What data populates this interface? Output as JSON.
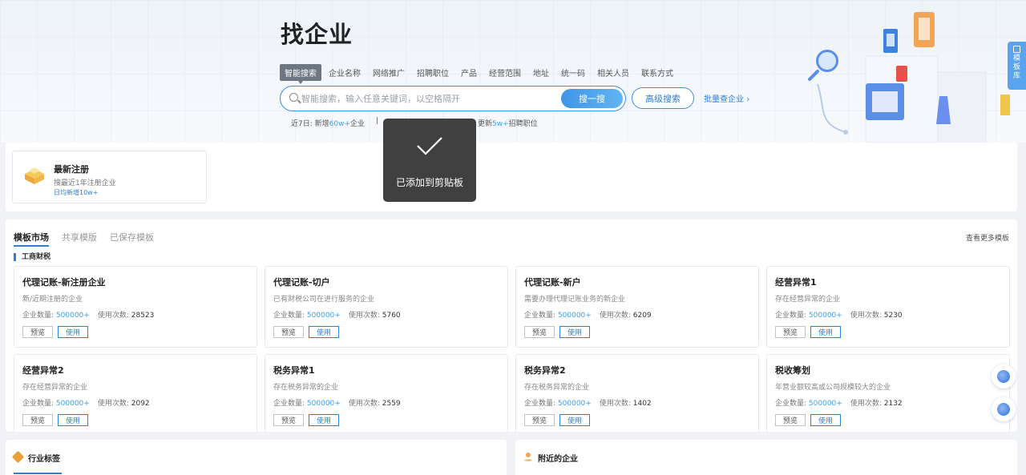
{
  "hero": {
    "title": "找企业",
    "tabs": [
      "智能搜索",
      "企业名称",
      "网络推广",
      "招聘职位",
      "产品",
      "经营范围",
      "地址",
      "统一码",
      "相关人员",
      "联系方式"
    ],
    "active_tab": "智能搜索",
    "search_placeholder": "智能搜索，输入任意关键词，以空格隔开",
    "search_button": "搜一搜",
    "advanced_button": "高级搜索",
    "batch_link": "批量查企业",
    "stats": {
      "prefix": "近7日:",
      "new_label": "新增",
      "new_count": "60w+",
      "new_suffix": "企业",
      "separator": "|",
      "update_label": "更新",
      "update_count": "5w+",
      "update_suffix": "招聘职位"
    }
  },
  "side_tab": {
    "label": "模板库"
  },
  "new_registration": {
    "title": "最新注册",
    "subtitle": "搜最近1年注册企业",
    "note": "日均新增10w+"
  },
  "toast": {
    "text": "已添加到剪贴板",
    "icon": "check-icon"
  },
  "templates": {
    "tabs": [
      "模板市场",
      "共享模版",
      "已保存模板"
    ],
    "active_tab": "模板市场",
    "more_link": "查看更多模板",
    "section_title": "工商财税",
    "count_label": "企业数量:",
    "uses_label": "使用次数:",
    "preview_label": "预览",
    "use_label": "使用",
    "cards": [
      {
        "title": "代理记账-新注册企业",
        "desc": "新/近期注册的企业",
        "count": "500000+",
        "uses": "28523"
      },
      {
        "title": "代理记账-切户",
        "desc": "已有财税公司在进行服务的企业",
        "count": "500000+",
        "uses": "5760"
      },
      {
        "title": "代理记账-新户",
        "desc": "需要办理代理记账业务的新企业",
        "count": "500000+",
        "uses": "6209"
      },
      {
        "title": "经营异常1",
        "desc": "存在经营异常的企业",
        "count": "500000+",
        "uses": "5230"
      },
      {
        "title": "经营异常2",
        "desc": "存在经营异常的企业",
        "count": "500000+",
        "uses": "2092"
      },
      {
        "title": "税务异常1",
        "desc": "存在税务异常的企业",
        "count": "500000+",
        "uses": "2559"
      },
      {
        "title": "税务异常2",
        "desc": "存在税务异常的企业",
        "count": "500000+",
        "uses": "1402"
      },
      {
        "title": "税收筹划",
        "desc": "年营业额较高或公司规模较大的企业",
        "count": "500000+",
        "uses": "2132"
      }
    ]
  },
  "bottom": {
    "industry_title": "行业标签",
    "nearby_title": "附近的企业"
  }
}
